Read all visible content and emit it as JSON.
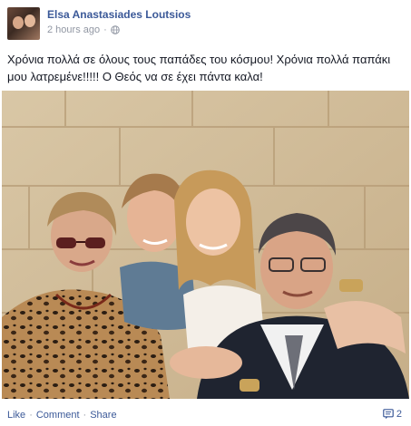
{
  "post": {
    "author": "Elsa Anastasiades Loutsios",
    "timestamp": "2 hours ago",
    "privacy_icon": "globe-icon",
    "text": "Χρόνια πολλά σε όλους τους παπάδες του κόσμου! Χρόνια πολλά παπάκι μου λατρεμένε!!!!! Ο Θεός να σε έχει πάντα καλα!",
    "photo_icon": "group-photo",
    "actions": {
      "like": "Like",
      "comment": "Comment",
      "share": "Share",
      "separator": "·"
    },
    "comment_count": "2",
    "comment_icon": "comment-bubble-icon"
  },
  "colors": {
    "link": "#3b5998",
    "meta": "#9197a3",
    "text": "#141823"
  }
}
